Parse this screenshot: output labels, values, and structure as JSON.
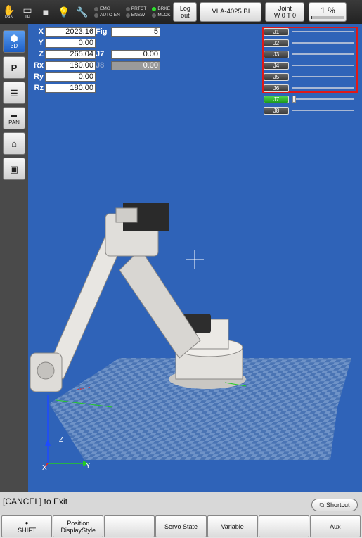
{
  "topbar": {
    "icons": [
      {
        "name": "pan-hand-icon",
        "label": "PAN"
      },
      {
        "name": "tp-icon",
        "label": "TP"
      },
      {
        "name": "stop-square-icon",
        "label": ""
      },
      {
        "name": "bulb-icon",
        "label": ""
      },
      {
        "name": "wrench-icon",
        "label": ""
      }
    ],
    "status": [
      {
        "label": "EMG",
        "on": false
      },
      {
        "label": "PRTCT",
        "on": false
      },
      {
        "label": "BRKE",
        "on": true
      },
      {
        "label": "AUTO EN",
        "on": false
      },
      {
        "label": "ENSW",
        "on": false
      },
      {
        "label": "MLCK",
        "on": false
      }
    ],
    "logout_line1": "Log",
    "logout_line2": "out",
    "model": "VLA-4025 BI",
    "joint_line1": "Joint",
    "joint_line2": "W 0 T 0",
    "speed": "1 %",
    "speed_level": 0.01
  },
  "lefttools": {
    "btn_3d": "3D",
    "btn_pan": "PAN"
  },
  "pose": {
    "x_label": "X",
    "x": "2023.16",
    "y_label": "Y",
    "y": "0.00",
    "z_label": "Z",
    "z": "265.04",
    "rx_label": "Rx",
    "rx": "180.00",
    "ry_label": "Ry",
    "ry": "0.00",
    "rz_label": "Rz",
    "rz": "180.00",
    "fig_label": "Fig",
    "fig": "5",
    "j7_label": "J7",
    "j7": "0.00",
    "j8_label": "J8",
    "j8": "0.00"
  },
  "joints": [
    {
      "label": "J1",
      "pos": 0
    },
    {
      "label": "J2",
      "pos": 0
    },
    {
      "label": "J3",
      "pos": 0
    },
    {
      "label": "J4",
      "pos": 0
    },
    {
      "label": "J5",
      "pos": 0
    },
    {
      "label": "J6",
      "pos": 0
    },
    {
      "label": "J7",
      "pos": 0
    },
    {
      "label": "J8",
      "pos": 0
    }
  ],
  "axes": {
    "x": "X",
    "y": "Y",
    "z": "Z"
  },
  "message": "[CANCEL] to Exit",
  "shortcut": "Shortcut",
  "softkeys": {
    "shift": "SHIFT",
    "position_line1": "Position",
    "position_line2": "DisplayStyle",
    "blank1": "",
    "servo": "Servo State",
    "variable": "Variable",
    "blank2": "",
    "aux": "Aux"
  }
}
